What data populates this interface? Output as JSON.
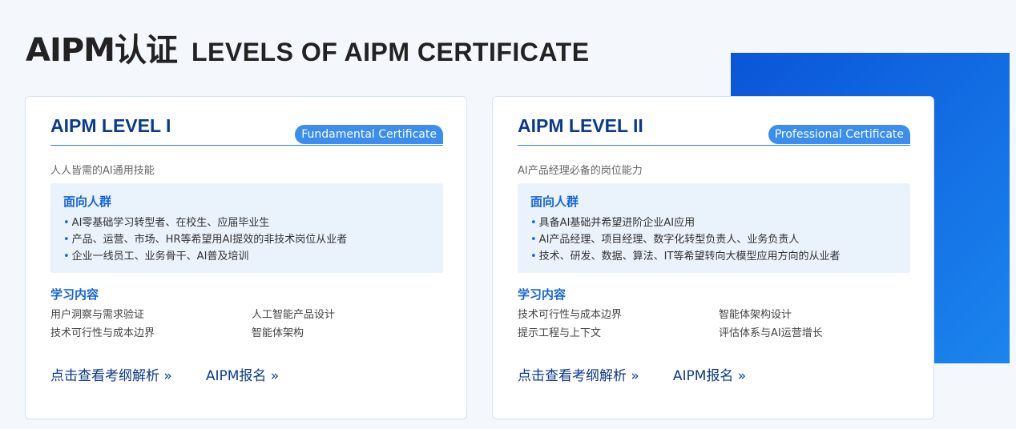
{
  "header": {
    "title_cn": "AIPM认证",
    "title_en": "LEVELS OF AIPM CERTIFICATE"
  },
  "colors": {
    "accent": "#1565d8",
    "title_blue": "#0b3a8c",
    "badge": "#3b8df0",
    "panel": "#eaf2fc"
  },
  "cards": [
    {
      "title": "AIPM LEVEL I",
      "badge": "Fundamental Certificate",
      "subtitle": "人人皆需的AI通用技能",
      "audience_title": "面向人群",
      "audience": [
        "AI零基础学习转型者、在校生、应届毕业生",
        "产品、运营、市场、HR等希望用AI提效的非技术岗位从业者",
        "企业一线员工、业务骨干、AI普及培训"
      ],
      "learn_title": "学习内容",
      "learn": [
        "用户洞察与需求验证",
        "人工智能产品设计",
        "技术可行性与成本边界",
        "智能体架构"
      ],
      "link_outline": "点击查看考纲解析 »",
      "link_signup": "AIPM报名 »"
    },
    {
      "title": "AIPM LEVEL II",
      "badge": "Professional Certificate",
      "subtitle": "AI产品经理必备的岗位能力",
      "audience_title": "面向人群",
      "audience": [
        "具备AI基础并希望进阶企业AI应用",
        "AI产品经理、项目经理、数字化转型负责人、业务负责人",
        "技术、研发、数据、算法、IT等希望转向大模型应用方向的从业者"
      ],
      "learn_title": "学习内容",
      "learn": [
        "技术可行性与成本边界",
        "智能体架构设计",
        "提示工程与上下文",
        "评估体系与AI运营增长"
      ],
      "link_outline": "点击查看考纲解析 »",
      "link_signup": "AIPM报名 »"
    }
  ]
}
